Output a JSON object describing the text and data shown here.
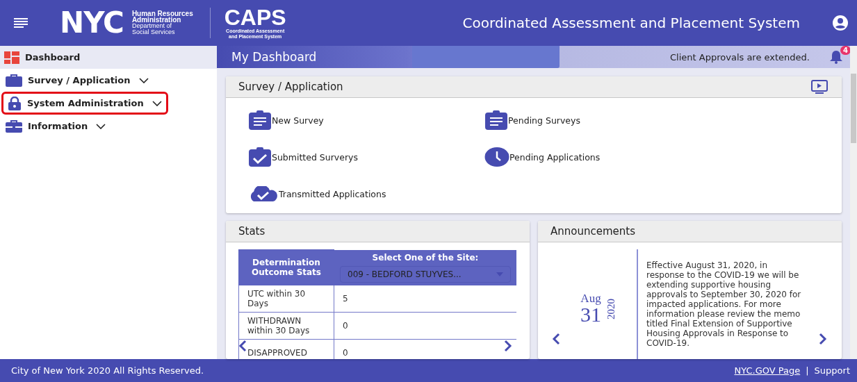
{
  "header": {
    "logo_text": "NYC",
    "agency_lines": [
      "Human Resources",
      "Administration",
      "Department of",
      "Social Services"
    ],
    "caps_title": "CAPS",
    "caps_lines": [
      "Coordinated Assessment",
      "and Placement System"
    ],
    "title": "Coordinated Assessment and Placement System"
  },
  "sidebar": {
    "items": [
      {
        "label": "Dashboard",
        "kind": "dashboard",
        "selected": true,
        "has_children": false,
        "highlighted": false
      },
      {
        "label": "Survey / Application",
        "kind": "briefcase",
        "selected": false,
        "has_children": true,
        "highlighted": false
      },
      {
        "label": "System Administration",
        "kind": "lock",
        "selected": false,
        "has_children": true,
        "highlighted": true
      },
      {
        "label": "Information",
        "kind": "toolbox",
        "selected": false,
        "has_children": true,
        "highlighted": false
      }
    ]
  },
  "subbar": {
    "title": "My Dashboard",
    "notice": "Client Approvals are extended.",
    "badge": "4"
  },
  "survey_card": {
    "title": "Survey / Application",
    "links": [
      {
        "label": "New Survey",
        "kind": "clipboard"
      },
      {
        "label": "Pending Surveys",
        "kind": "clipboard"
      },
      {
        "label": "Submitted Surverys",
        "kind": "clipboard-check"
      },
      {
        "label": "Pending Applications",
        "kind": "clock"
      },
      {
        "label": "Transmitted Applications",
        "kind": "cloud-check"
      }
    ]
  },
  "stats": {
    "title": "Stats",
    "column_1": "Determination Outcome Stats",
    "column_2": "Select One of the Site:",
    "site_select": "009 - BEDFORD STUYVES...",
    "rows": [
      {
        "label": "UTC within 30 Days",
        "value": "5"
      },
      {
        "label": "WITHDRAWN within 30 Days",
        "value": "0"
      },
      {
        "label": "DISAPPROVED",
        "value": "0"
      }
    ]
  },
  "announcements": {
    "title": "Announcements",
    "month": "Aug",
    "day": "31",
    "year": "2020",
    "text": "Effective August 31, 2020, in response to the COVID-19 we will be extending supportive housing approvals to September 30, 2020 for impacted applications. For more information please review the memo titled Final Extension of Supportive Housing Approvals in Response to COVID-19."
  },
  "footer": {
    "copyright": "City of New York 2020 All Rights Reserved.",
    "links": [
      "NYC.GOV Page",
      "Support"
    ],
    "separator": "|"
  }
}
